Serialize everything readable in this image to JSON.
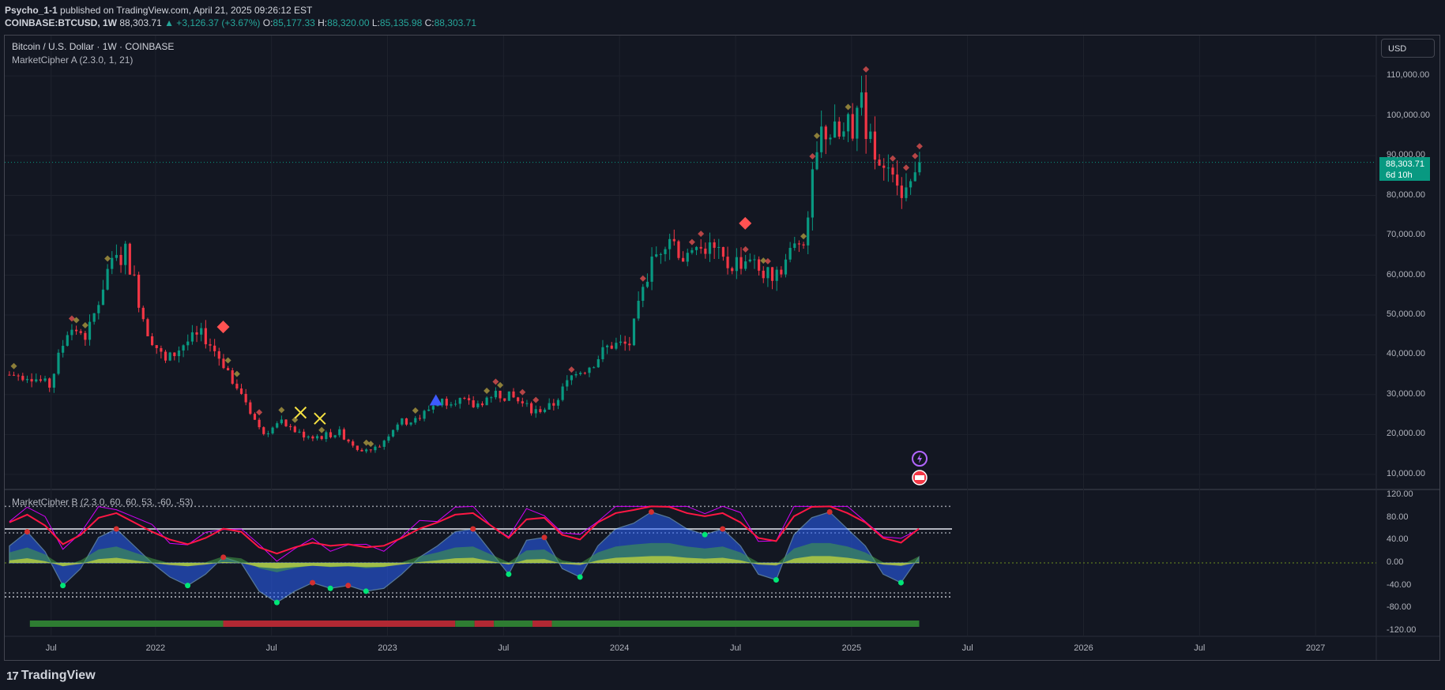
{
  "header": {
    "author": "Psycho_1-1",
    "published": "published on TradingView.com, April 21, 2025 09:26:12 EST",
    "symbol": "COINBASE:BTCUSD, 1W",
    "last": "88,303.71",
    "change": "▲ +3,126.37 (+3.67%)",
    "open_label": "O:",
    "open": "85,177.33",
    "high_label": "H:",
    "high": "88,320.00",
    "low_label": "L:",
    "low": "85,135.98",
    "close_label": "C:",
    "close": "88,303.71"
  },
  "legend": {
    "title": "Bitcoin / U.S. Dollar · 1W · COINBASE",
    "indicator_a": "MarketCipher A (2.3.0, 1, 21)",
    "indicator_b": "MarketCipher B (2.3.0, 60, 60, 53, -60, -53)"
  },
  "currency_button": "USD",
  "price_tag": {
    "price": "88,303.71",
    "countdown": "6d 10h"
  },
  "footer": {
    "brand": "TradingView"
  },
  "colors": {
    "background": "#131722",
    "up": "#089981",
    "down": "#f23645",
    "wave": "#2962ff",
    "mf_green": "#2e7d32",
    "mf_red": "#b22833"
  },
  "chart_data": [
    {
      "type": "candlestick",
      "title": "Bitcoin / U.S. Dollar · 1W · COINBASE",
      "y_ticks": [
        "110,000.00",
        "100,000.00",
        "90,000.00",
        "80,000.00",
        "70,000.00",
        "60,000.00",
        "50,000.00",
        "40,000.00",
        "30,000.00",
        "20,000.00",
        "10,000.00"
      ],
      "x_ticks": [
        "Jul",
        "2022",
        "Jul",
        "2023",
        "Jul",
        "2024",
        "Jul",
        "2025",
        "Jul",
        "2026",
        "Jul",
        "2027"
      ],
      "ylim": [
        7000,
        113000
      ],
      "last_price": 88303.71,
      "close_path": [
        [
          "2021-06",
          35000
        ],
        [
          "2021-07",
          32000
        ],
        [
          "2021-08",
          47000
        ],
        [
          "2021-09",
          45000
        ],
        [
          "2021-10",
          61000
        ],
        [
          "2021-11",
          66000
        ],
        [
          "2021-12",
          47000
        ],
        [
          "2022-01",
          38000
        ],
        [
          "2022-02",
          43000
        ],
        [
          "2022-03",
          45000
        ],
        [
          "2022-04",
          38000
        ],
        [
          "2022-05",
          30000
        ],
        [
          "2022-06",
          20000
        ],
        [
          "2022-07",
          23000
        ],
        [
          "2022-08",
          20000
        ],
        [
          "2022-09",
          19500
        ],
        [
          "2022-10",
          20500
        ],
        [
          "2022-11",
          16500
        ],
        [
          "2022-12",
          16600
        ],
        [
          "2023-01",
          23000
        ],
        [
          "2023-02",
          23500
        ],
        [
          "2023-03",
          28000
        ],
        [
          "2023-04",
          29000
        ],
        [
          "2023-05",
          27000
        ],
        [
          "2023-06",
          30500
        ],
        [
          "2023-07",
          29200
        ],
        [
          "2023-08",
          26000
        ],
        [
          "2023-09",
          27000
        ],
        [
          "2023-10",
          34500
        ],
        [
          "2023-11",
          37500
        ],
        [
          "2023-12",
          42500
        ],
        [
          "2024-01",
          42500
        ],
        [
          "2024-02",
          61000
        ],
        [
          "2024-03",
          71000
        ],
        [
          "2024-04",
          63000
        ],
        [
          "2024-05",
          67500
        ],
        [
          "2024-06",
          62500
        ],
        [
          "2024-07",
          64000
        ],
        [
          "2024-08",
          59000
        ],
        [
          "2024-09",
          63000
        ],
        [
          "2024-10",
          70000
        ],
        [
          "2024-11",
          97000
        ],
        [
          "2024-12",
          94000
        ],
        [
          "2025-01",
          102000
        ],
        [
          "2025-02",
          84500
        ],
        [
          "2025-03",
          82500
        ],
        [
          "2025-04",
          88303.71
        ]
      ],
      "signals": {
        "buy_triangle": [
          [
            "2023-03",
            28500
          ]
        ],
        "yellow_cross": [
          [
            "2022-08",
            25500
          ],
          [
            "2022-09",
            24000
          ]
        ],
        "big_red_diamond": [
          [
            "2022-04",
            47000
          ],
          [
            "2024-07",
            73000
          ]
        ]
      }
    },
    {
      "type": "oscillator",
      "title": "MarketCipher B (2.3.0, 60, 60, 53, -60, -53)",
      "y_ticks": [
        "120.00",
        "80.00",
        "40.00",
        "0.00",
        "-40.00",
        "-80.00",
        "-120.00"
      ],
      "ylim": [
        -120,
        120
      ],
      "levels": [
        100,
        60,
        53,
        -53,
        -60
      ],
      "wave": [
        30,
        55,
        20,
        -40,
        -10,
        45,
        60,
        30,
        0,
        -25,
        -40,
        -20,
        10,
        0,
        -50,
        -70,
        -50,
        -35,
        -45,
        -40,
        -50,
        -45,
        -20,
        10,
        30,
        55,
        60,
        20,
        -20,
        40,
        45,
        -10,
        -25,
        30,
        60,
        70,
        90,
        80,
        60,
        50,
        60,
        30,
        -20,
        -30,
        50,
        80,
        90,
        60,
        30,
        -20,
        -35,
        10
      ],
      "mfi_bar": [
        {
          "from": "2021-06",
          "to": "2022-04",
          "state": "green"
        },
        {
          "from": "2022-04",
          "to": "2023-04",
          "state": "red"
        },
        {
          "from": "2023-04",
          "to": "2023-05",
          "state": "green"
        },
        {
          "from": "2023-05",
          "to": "2023-06",
          "state": "red"
        },
        {
          "from": "2023-06",
          "to": "2023-08",
          "state": "green"
        },
        {
          "from": "2023-08",
          "to": "2023-09",
          "state": "red"
        },
        {
          "from": "2023-09",
          "to": "2025-04",
          "state": "green"
        }
      ]
    }
  ]
}
